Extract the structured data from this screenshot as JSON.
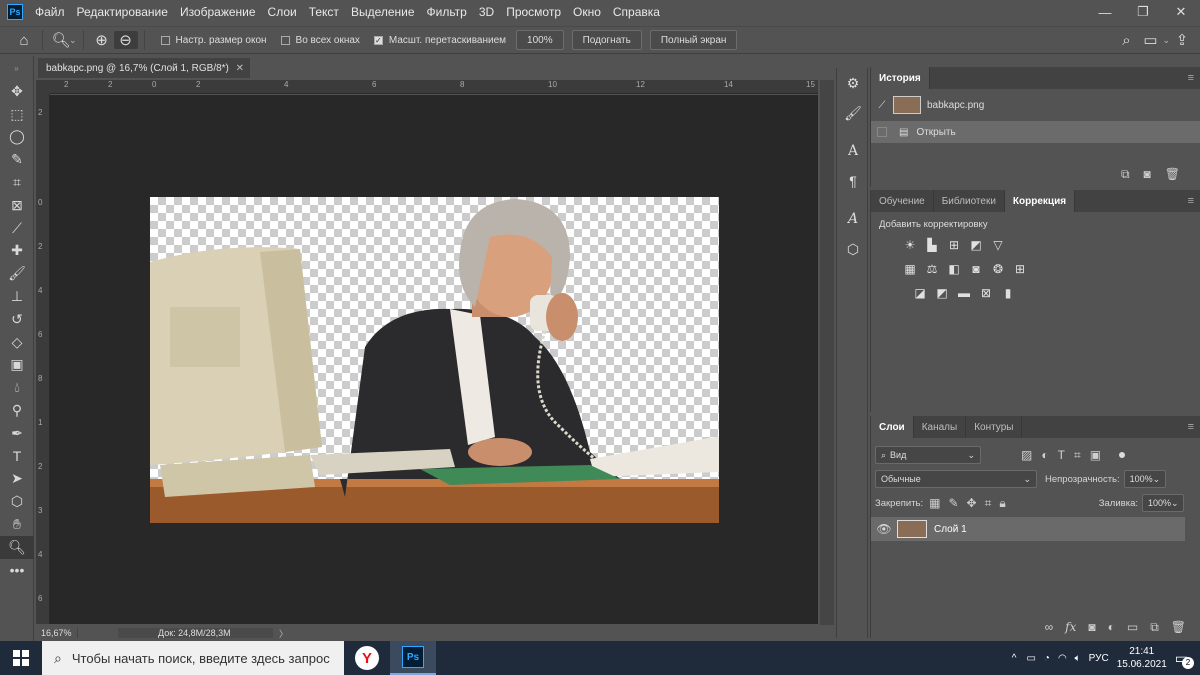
{
  "menu": {
    "logo": "Ps",
    "items": [
      "Файл",
      "Редактирование",
      "Изображение",
      "Слои",
      "Текст",
      "Выделение",
      "Фильтр",
      "3D",
      "Просмотр",
      "Окно",
      "Справка"
    ]
  },
  "options": {
    "chk_resize": "Настр. размер окон",
    "chk_all": "Во всех окнах",
    "chk_scrub": "Масшт. перетаскиванием",
    "zoom_value": "100%",
    "fit_button": "Подогнать",
    "fullscreen_button": "Полный экран"
  },
  "document": {
    "tab_title": "babkapc.png @ 16,7% (Слой 1, RGB/8*)",
    "ruler_h": [
      "2",
      "2",
      "0",
      "2",
      "4",
      "6",
      "8",
      "10",
      "12",
      "14",
      "15"
    ],
    "ruler_v": [
      "2",
      "0",
      "2",
      "4",
      "6",
      "8",
      "1",
      "2",
      "3",
      "4",
      "6",
      "9"
    ],
    "status_zoom": "16,67%",
    "status_doc": "Док: 24,8M/28,3M"
  },
  "history": {
    "tab": "История",
    "items": [
      {
        "label": "babkapc.png"
      },
      {
        "label": "Открыть"
      }
    ]
  },
  "adjust": {
    "tabs": [
      "Обучение",
      "Библиотеки",
      "Коррекция"
    ],
    "active_tab": "Коррекция",
    "title": "Добавить корректировку"
  },
  "layers": {
    "tabs": [
      "Слои",
      "Каналы",
      "Контуры"
    ],
    "filter": "Вид",
    "blend_mode": "Обычные",
    "opacity_label": "Непрозрачность:",
    "opacity_value": "100%",
    "lock_label": "Закрепить:",
    "fill_label": "Заливка:",
    "fill_value": "100%",
    "layer_name": "Слой 1"
  },
  "taskbar": {
    "search_placeholder": "Чтобы начать поиск, введите здесь запрос",
    "lang": "РУС",
    "time": "21:41",
    "date": "15.06.2021",
    "notifications": "2"
  }
}
